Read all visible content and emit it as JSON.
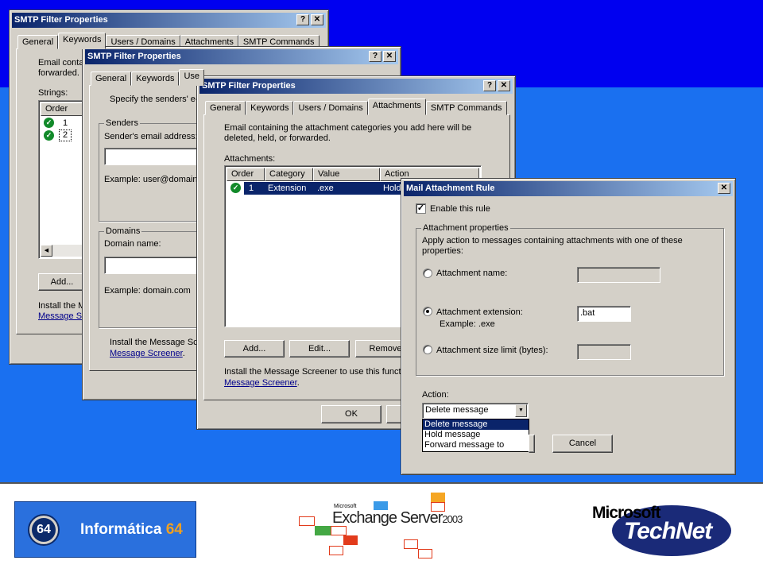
{
  "window1": {
    "title": "SMTP Filter Properties",
    "tabs": [
      "General",
      "Keywords",
      "Users / Domains",
      "Attachments",
      "SMTP Commands"
    ],
    "active_tab": "Keywords",
    "intro_line1": "Email conta",
    "intro_line2": "forwarded.",
    "strings_label": "Strings:",
    "col_order": "Order",
    "rows": [
      "1",
      "2"
    ],
    "add_button": "Add...",
    "install_text": "Install the M",
    "install_link": "Message Sc"
  },
  "window2": {
    "title": "SMTP Filter Properties",
    "tabs": [
      "General",
      "Keywords",
      "Use"
    ],
    "specify_text": "Specify the senders' e-",
    "senders_group": "Senders",
    "sender_email_label": "Sender's email address:",
    "example_email": "Example: user@domain.c",
    "domains_group": "Domains",
    "domain_name_label": "Domain name:",
    "example_domain": "Example: domain.com",
    "install_text": "Install the Message Sc",
    "install_link": "Message Screener",
    "install_tail": "."
  },
  "window3": {
    "title": "SMTP Filter Properties",
    "tabs": [
      "General",
      "Keywords",
      "Users / Domains",
      "Attachments",
      "SMTP Commands"
    ],
    "active_tab": "Attachments",
    "description_line1": "Email containing the attachment categories you add here will be",
    "description_line2": "deleted, held, or forwarded.",
    "attachments_label": "Attachments:",
    "columns": [
      "Order",
      "Category",
      "Value",
      "Action"
    ],
    "row": {
      "order": "1",
      "category": "Extension",
      "value": ".exe",
      "action": "Hold"
    },
    "add_button": "Add...",
    "edit_button": "Edit...",
    "remove_button": "Remove",
    "install_text": "Install the Message Screener to use this functio",
    "install_link": "Message Screener",
    "install_tail": ".",
    "ok_button": "OK"
  },
  "dialog": {
    "title": "Mail Attachment Rule",
    "enable_label": "Enable this rule",
    "enable_checked": true,
    "group_label": "Attachment properties",
    "group_desc_line1": "Apply action to messages containing attachments with one of these",
    "group_desc_line2": "properties:",
    "option_name": "Attachment name:",
    "option_extension": "Attachment extension:",
    "extension_value": ".bat",
    "extension_example": "Example: .exe",
    "option_size": "Attachment size limit (bytes):",
    "selected_option": "extension",
    "action_label": "Action:",
    "action_value": "Delete message",
    "action_options": [
      "Delete message",
      "Hold message",
      "Forward message to"
    ],
    "cancel_button": "Cancel"
  },
  "logos": {
    "informatica_number": "64",
    "informatica_text": "Informática",
    "informatica_number_suffix": "64",
    "exchange_brand": "Microsoft",
    "exchange_name": "Exchange Server",
    "exchange_year": "2003",
    "technet_brand": "Microsoft",
    "technet_name": "TechNet"
  },
  "colors": {
    "titlebar_start": "#0a246a",
    "titlebar_end": "#a6caf0",
    "background_blue": "#1a70f0",
    "dark_blue": "#0000f0",
    "technet_navy": "#1a2a78"
  }
}
